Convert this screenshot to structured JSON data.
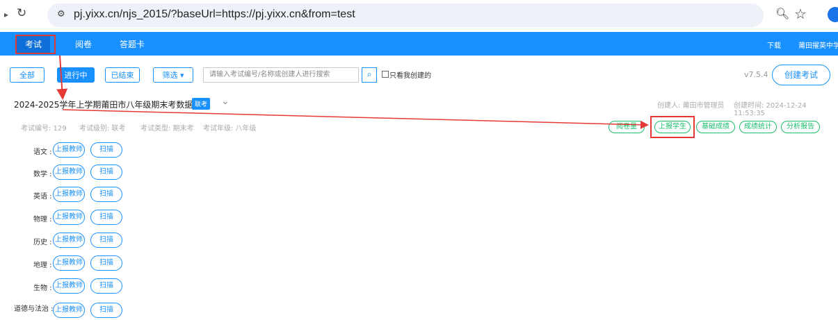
{
  "browser": {
    "url": "pj.yixx.cn/njs_2015/?baseUrl=https://pj.yixx.cn&from=test"
  },
  "topnav": {
    "items": [
      "考试",
      "阅卷",
      "答题卡"
    ],
    "right": [
      "下载",
      "莆田擢英中学"
    ]
  },
  "toolbar": {
    "filters": [
      "全部",
      "进行中",
      "已结束",
      "筛选 ▾"
    ],
    "search_placeholder": "请输入考试编号/名称或创建人进行搜索",
    "only_mine": "只看我创建的",
    "version": "v7.5.4",
    "create": "创建考试"
  },
  "exam": {
    "title": "2024-2025学年上学期莆田市八年级期末考数据上报",
    "tag": "联考",
    "creator": "创建人: 莆田市管理员",
    "created_time": "创建时间: 2024-12-24 11:53:35",
    "meta": [
      "考试编号: 129",
      "考试级别: 联考",
      "考试类型: 期末考",
      "考试年级: 八年级"
    ],
    "actions": [
      "阅卷量",
      "上报学生",
      "基础成绩",
      "成绩统计",
      "分析报告"
    ]
  },
  "subjects": [
    {
      "name": "语文 :",
      "report": "上报教师",
      "scan": "扫描"
    },
    {
      "name": "数学 :",
      "report": "上报教师",
      "scan": "扫描"
    },
    {
      "name": "英语 :",
      "report": "上报教师",
      "scan": "扫描"
    },
    {
      "name": "物理 :",
      "report": "上报教师",
      "scan": "扫描"
    },
    {
      "name": "历史 :",
      "report": "上报教师",
      "scan": "扫描"
    },
    {
      "name": "地理 :",
      "report": "上报教师",
      "scan": "扫描"
    },
    {
      "name": "生物 :",
      "report": "上报教师",
      "scan": "扫描"
    },
    {
      "name": "道德与法治 :",
      "report": "上报教师",
      "scan": "扫描"
    }
  ],
  "colors": {
    "accent": "#1890ff",
    "highlight": "#e53935",
    "green": "#19be6b"
  }
}
